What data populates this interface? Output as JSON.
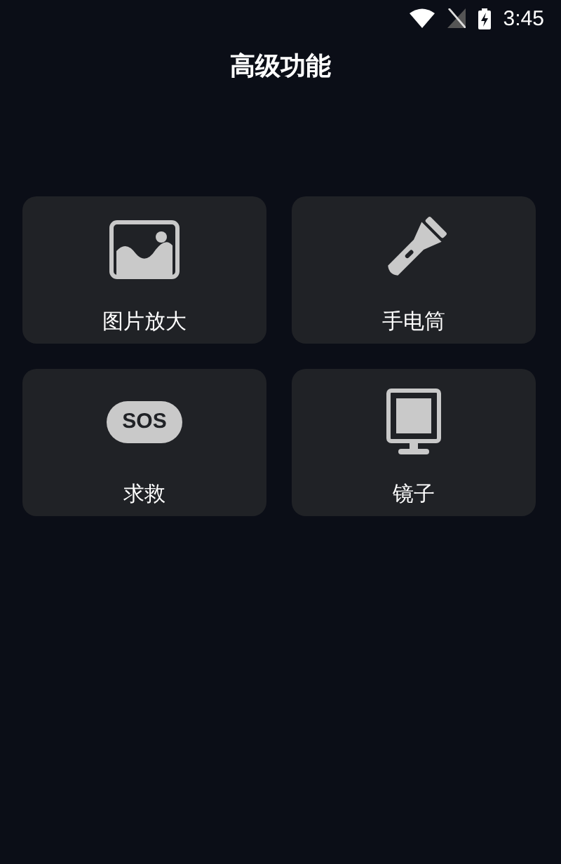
{
  "status_bar": {
    "time": "3:45"
  },
  "title": "高级功能",
  "features": [
    {
      "kind": "image",
      "label": "图片放大"
    },
    {
      "kind": "flashlight",
      "label": "手电筒"
    },
    {
      "kind": "sos",
      "icon_text": "SOS",
      "label": "求救"
    },
    {
      "kind": "mirror",
      "label": "镜子"
    }
  ]
}
